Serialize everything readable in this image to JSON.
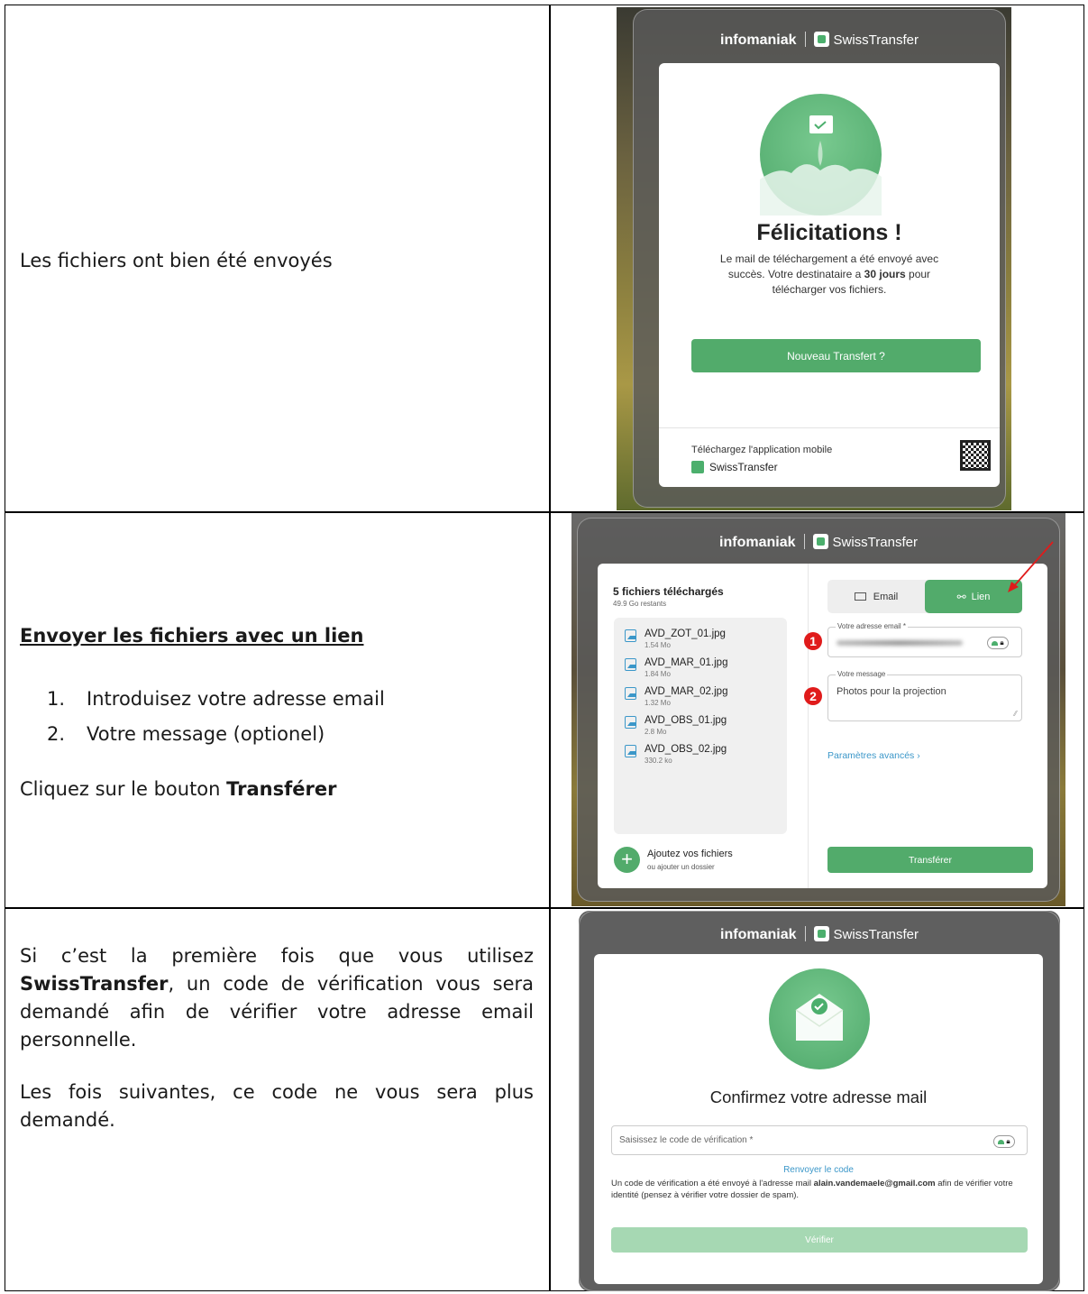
{
  "row1": {
    "text": "Les fichiers ont bien été envoyés",
    "shot": {
      "brand_left": "infomaniak",
      "brand_right": "SwissTransfer",
      "title": "Félicitations !",
      "message_a": "Le mail de téléchargement a été envoyé avec succès. Votre destinataire a ",
      "message_bold": "30 jours",
      "message_b": " pour télécharger vos fichiers.",
      "button": "Nouveau Transfert ?",
      "footer_label": "Téléchargez l'application mobile",
      "footer_app": "SwissTransfer"
    }
  },
  "row2": {
    "heading": "Envoyer les fichiers avec un lien",
    "steps": [
      "Introduisez votre adresse email",
      "Votre message (optionel)"
    ],
    "instr_a": "Cliquez sur le bouton ",
    "instr_bold": "Transférer",
    "shot": {
      "brand_left": "infomaniak",
      "brand_right": "SwissTransfer",
      "files_title": "5 fichiers téléchargés",
      "files_remaining": "49.9 Go restants",
      "files": [
        {
          "name": "AVD_ZOT_01.jpg",
          "size": "1.54 Mo"
        },
        {
          "name": "AVD_MAR_01.jpg",
          "size": "1.84 Mo"
        },
        {
          "name": "AVD_MAR_02.jpg",
          "size": "1.32 Mo"
        },
        {
          "name": "AVD_OBS_01.jpg",
          "size": "2.8 Mo"
        },
        {
          "name": "AVD_OBS_02.jpg",
          "size": "330.2 ko"
        }
      ],
      "add_files": "Ajoutez vos fichiers",
      "add_folder": "ou ajouter un dossier",
      "tab_email": "Email",
      "tab_link": "Lien",
      "email_label": "Votre adresse email *",
      "message_label": "Votre message",
      "message_value": "Photos pour la projection",
      "advanced": "Paramètres avancés",
      "submit": "Transférer",
      "badge1": "1",
      "badge2": "2"
    }
  },
  "row3": {
    "para1_a": "Si c’est la première fois que vous utilisez ",
    "para1_bold": "SwissTransfer",
    "para1_b": ", un code de vérification vous sera demandé afin de vérifier votre adresse email personnelle.",
    "para2": "Les fois suivantes, ce code ne vous sera plus demandé.",
    "shot": {
      "brand_left": "infomaniak",
      "brand_right": "SwissTransfer",
      "title": "Confirmez votre adresse mail",
      "code_placeholder": "Saisissez le code de vérification *",
      "resend": "Renvoyer le code",
      "notice_a": "Un code de vérification a été envoyé à l'adresse mail ",
      "notice_email": "alain.vandemaele@gmail.com",
      "notice_b": " afin de vérifier votre identité (pensez à vérifier votre dossier de spam).",
      "verify": "Vérifier"
    }
  }
}
